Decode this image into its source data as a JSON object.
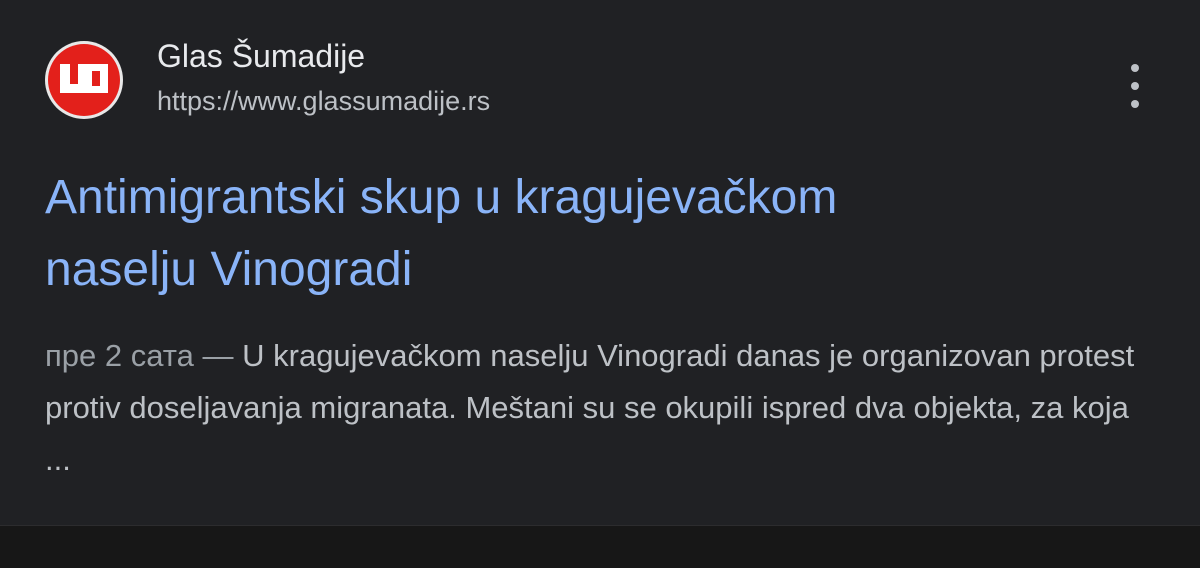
{
  "result": {
    "site_name": "Glas Šumadije",
    "url": "https://www.glassumadije.rs",
    "favicon": {
      "icon": "glas-sumadije-logo",
      "letters": "ŠU",
      "color": "#e3201b"
    },
    "menu_icon": "more-vert-icon",
    "title_line1": "Antimigrantski skup u kragujevačkom",
    "title_line2": "naselju Vinogradi",
    "date": "пре 2 сата",
    "separator": " — ",
    "snippet": "U kragujevačkom naselju Vinogradi danas je organizovan protest protiv doseljavanja migranata. Meštani su se okupili ispred dva objekta, za koja ..."
  },
  "colors": {
    "background": "#202124",
    "title_link": "#8ab4f8",
    "site_name": "#e8eaed",
    "secondary_text": "#bdc1c6"
  }
}
